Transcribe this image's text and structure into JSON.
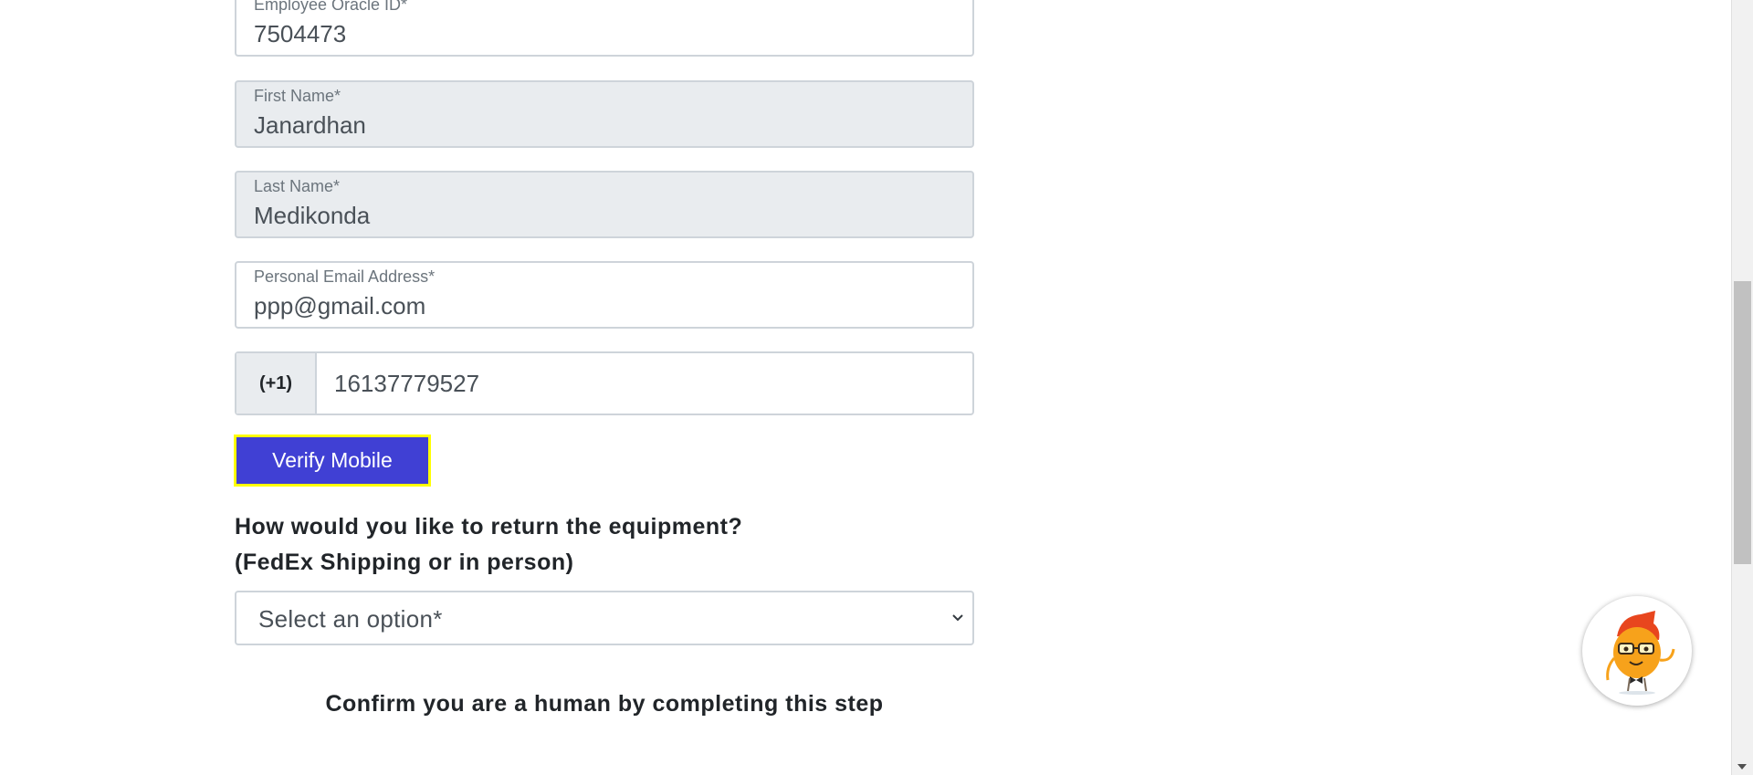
{
  "form": {
    "employee_id": {
      "label": "Employee Oracle ID*",
      "value": "7504473"
    },
    "first_name": {
      "label": "First Name*",
      "value": "Janardhan"
    },
    "last_name": {
      "label": "Last Name*",
      "value": "Medikonda"
    },
    "email": {
      "label": "Personal Email Address*",
      "value": "ppp@gmail.com"
    },
    "phone": {
      "prefix": "(+1)",
      "value": "16137779527"
    },
    "verify_button": "Verify Mobile",
    "return_question": "How would you like to return the equipment? (FedEx Shipping or in person)",
    "return_select": {
      "selected": "Select an option*"
    },
    "captcha_prompt": "Confirm you are a human by completing this step"
  },
  "colors": {
    "verify_button_bg": "#4040d4",
    "verify_button_border": "#ffff00",
    "disabled_field_bg": "#e9ecef"
  },
  "icons": {
    "select_chevron": "chevron-down-icon",
    "chat_assistant": "mascot-chat-icon"
  }
}
